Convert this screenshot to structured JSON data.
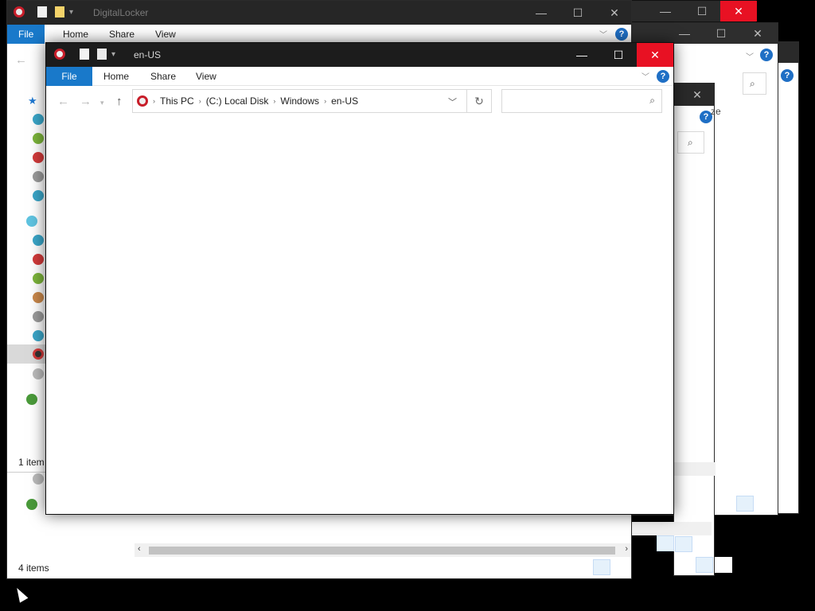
{
  "back_window": {
    "title": "DigitalLocker",
    "tabs": {
      "file": "File",
      "home": "Home",
      "share": "Share",
      "view": "View"
    },
    "status_top": "1 item",
    "status_bottom": "4 items"
  },
  "side_window": {
    "partial_text": "ze"
  },
  "main_window": {
    "title": "en-US",
    "tabs": {
      "file": "File",
      "home": "Home",
      "share": "Share",
      "view": "View"
    },
    "breadcrumb": [
      "This PC",
      "(C:) Local Disk",
      "Windows",
      "en-US"
    ],
    "search_placeholder": ""
  },
  "caption": {
    "minimize": "—",
    "maximize": "☐",
    "close": "✕"
  },
  "help_glyph": "?",
  "colors": {
    "file_tab": "#1979ca",
    "close_hover": "#e81123",
    "titlebar": "#1c1c1c"
  }
}
